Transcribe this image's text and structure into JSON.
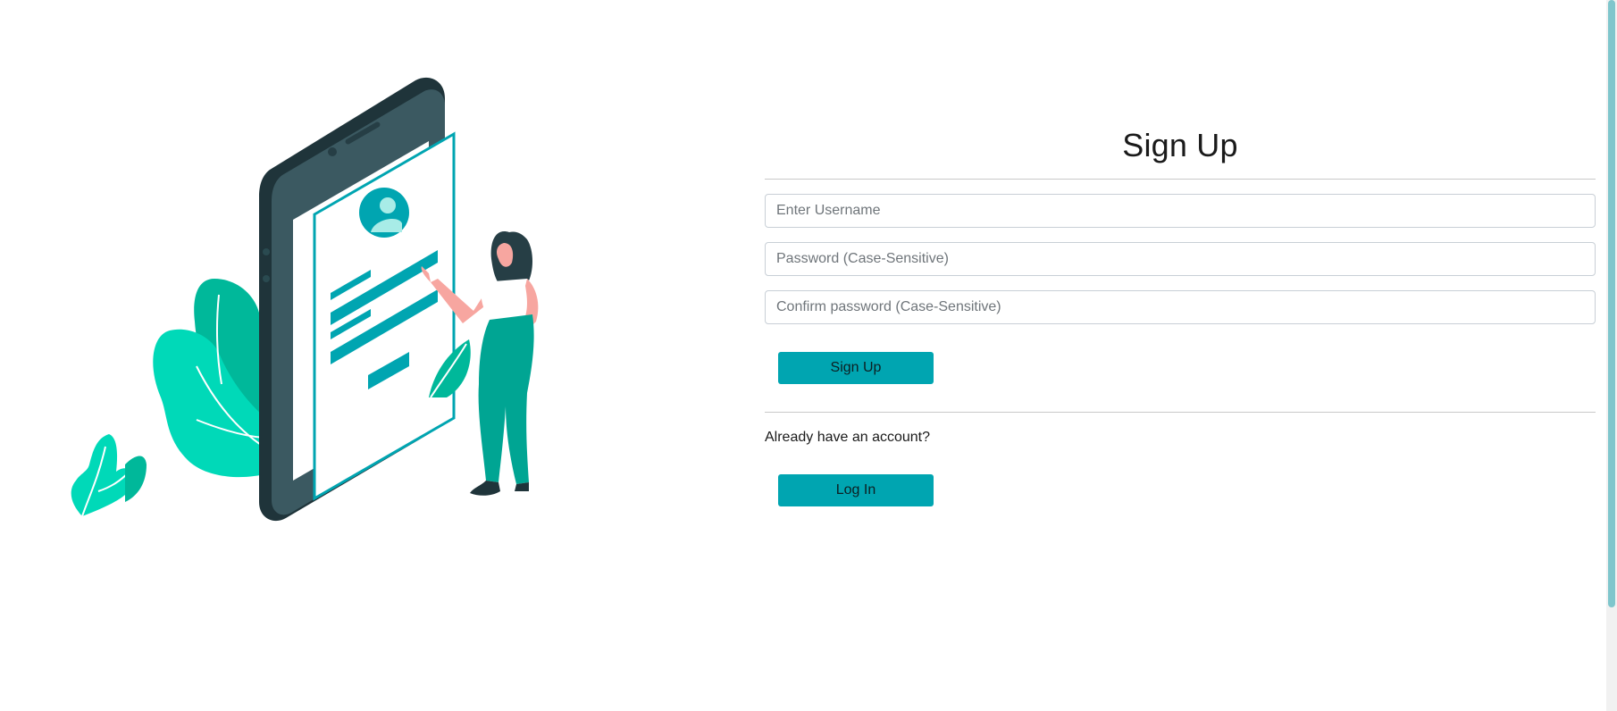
{
  "form": {
    "title": "Sign Up",
    "username_placeholder": "Enter Username",
    "password_placeholder": "Password (Case-Sensitive)",
    "confirm_placeholder": "Confirm password (Case-Sensitive)",
    "signup_label": "Sign Up",
    "account_prompt": "Already have an account?",
    "login_label": "Log In"
  },
  "colors": {
    "accent": "#00a5b1",
    "phone_dark": "#263e45",
    "plant_green": "#00d9b8",
    "skin": "#f7a6a0"
  }
}
